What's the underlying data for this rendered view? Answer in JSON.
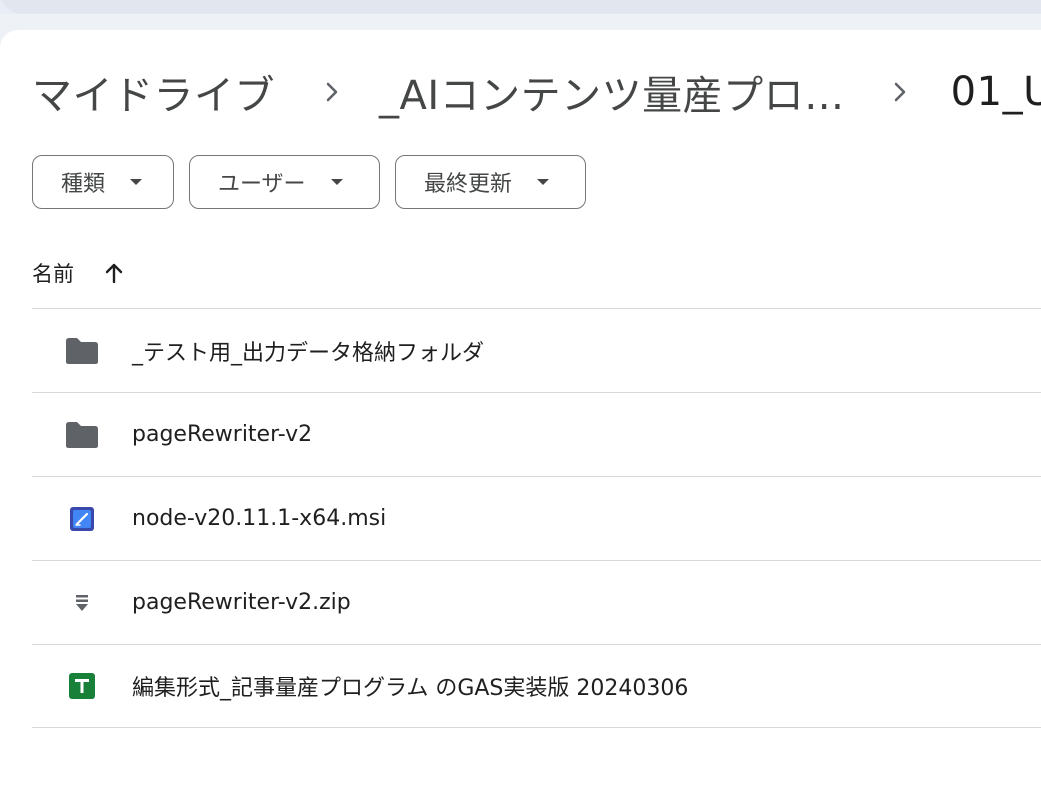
{
  "breadcrumb": {
    "items": [
      "マイドライブ",
      "_AIコンテンツ量産プロ…",
      "01_U"
    ]
  },
  "filters": [
    {
      "label": "種類"
    },
    {
      "label": "ユーザー"
    },
    {
      "label": "最終更新"
    }
  ],
  "list": {
    "sort_column": "名前",
    "sort_direction_icon": "arrow-up-icon",
    "rows": [
      {
        "name": "_テスト用_出力データ格納フォルダ",
        "icon": "folder-icon"
      },
      {
        "name": "pageRewriter-v2",
        "icon": "folder-icon"
      },
      {
        "name": "node-v20.11.1-x64.msi",
        "icon": "installer-icon"
      },
      {
        "name": "pageRewriter-v2.zip",
        "icon": "zip-icon"
      },
      {
        "name": "編集形式_記事量産プログラム のGAS実装版 20240306",
        "icon": "sheets-icon"
      }
    ]
  },
  "colors": {
    "folder": "#5f6368",
    "sheets": "#188038",
    "installer": "#3f51b5",
    "border": "#d5d7da",
    "chip_border": "#747775"
  }
}
